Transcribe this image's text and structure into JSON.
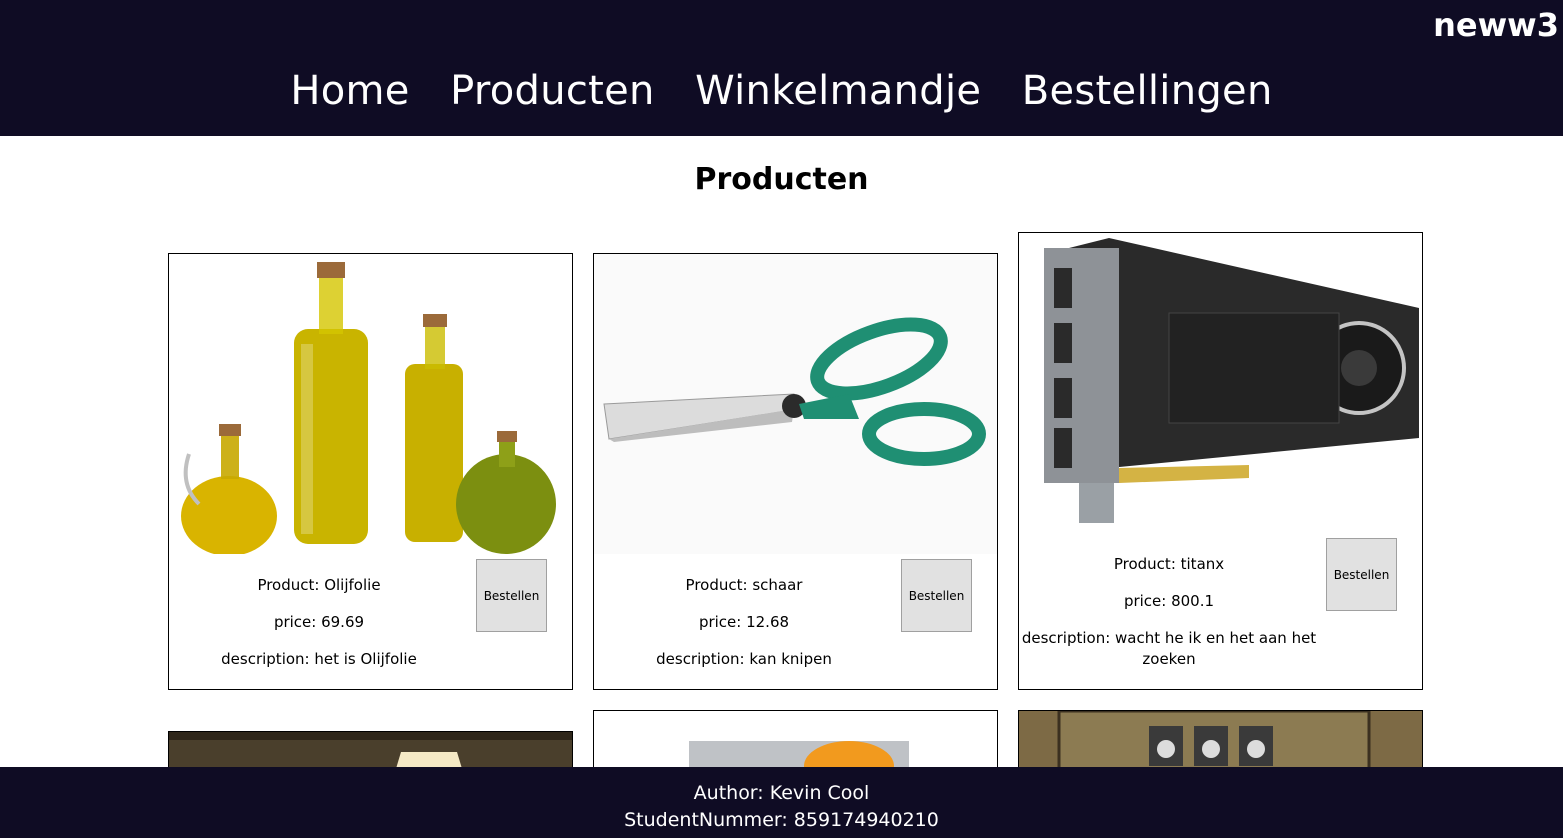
{
  "header": {
    "username": "neww3",
    "nav": [
      "Home",
      "Producten",
      "Winkelmandje",
      "Bestellingen"
    ]
  },
  "page": {
    "title": "Producten"
  },
  "products": [
    {
      "name": "Product: Olijfolie",
      "price": "price: 69.69",
      "description": "description: het is Olijfolie",
      "button": "Bestellen",
      "image": "olive-oil-bottles"
    },
    {
      "name": "Product: schaar",
      "price": "price: 12.68",
      "description": "description: kan knipen",
      "button": "Bestellen",
      "image": "green-scissors"
    },
    {
      "name": "Product: titanx",
      "price": "price: 800.1",
      "description": "description: wacht he ik en het aan het zoeken",
      "button": "Bestellen",
      "image": "graphics-card"
    },
    {
      "image": "lamp"
    },
    {
      "image": "orange-box"
    },
    {
      "image": "game-map"
    }
  ],
  "footer": {
    "author": "Author: Kevin Cool",
    "student": "StudentNummer: 859174940210"
  },
  "colors": {
    "header_bg": "#0f0c24",
    "footer_bg": "#0f0c24",
    "button_bg": "#e1e1e1"
  }
}
